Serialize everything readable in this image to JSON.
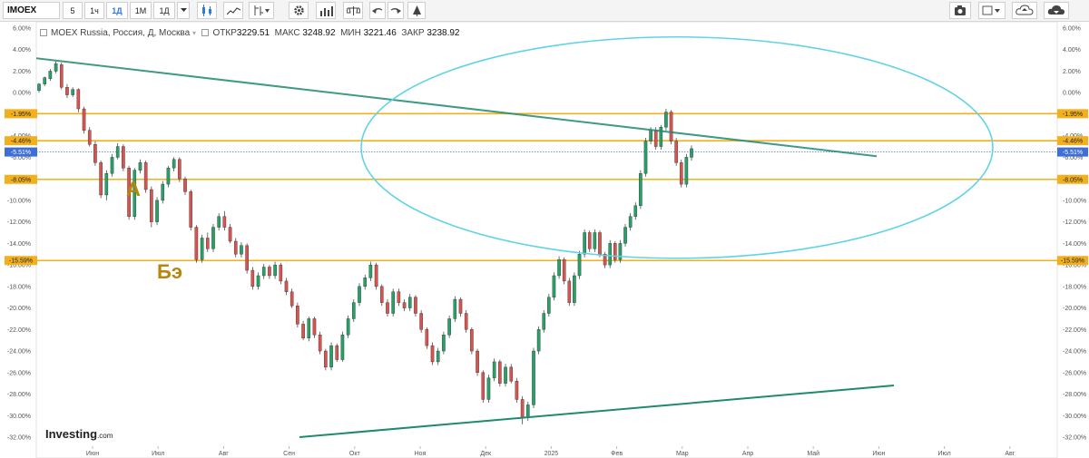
{
  "toolbar": {
    "symbol": "IMOEX",
    "intervals": [
      "5",
      "1ч",
      "1Д",
      "1М",
      "1Д"
    ],
    "active_interval": "1Д",
    "icons": [
      "candles-icon",
      "area-icon",
      "indicators-icon",
      "settings-icon",
      "volume-icon",
      "compare-icon",
      "undo-icon",
      "redo-icon",
      "drawing-icon",
      "camera-icon",
      "color-icon",
      "cloud-upload-icon",
      "cloud-download-icon"
    ]
  },
  "info": {
    "name": "MOEX Russia, Россия, Д, Москва",
    "open_label": "ОТКР",
    "open_value": "3229.51",
    "high_label": "МАКС",
    "high_value": "3248.92",
    "low_label": "МИН",
    "low_value": "3221.46",
    "close_label": "ЗАКР",
    "close_value": "3238.92"
  },
  "brand": "Investing",
  "brand_suffix": ".com",
  "annotations": {
    "a": "А",
    "be": "Бэ"
  },
  "chart_data": {
    "type": "candlestick",
    "y_unit": "%",
    "ylim": [
      -32.0,
      6.0
    ],
    "y_ticks": [
      "6.00%",
      "4.00%",
      "2.00%",
      "0.00%",
      "-2.00%",
      "-4.00%",
      "-6.00%",
      "-8.00%",
      "-10.00%",
      "-12.00%",
      "-14.00%",
      "-16.00%",
      "-18.00%",
      "-20.00%",
      "-22.00%",
      "-24.00%",
      "-26.00%",
      "-28.00%",
      "-30.00%",
      "-32.00%"
    ],
    "x_labels": [
      "Июн",
      "Июл",
      "Авг",
      "Сен",
      "Окт",
      "Ноя",
      "Дек",
      "2025",
      "Фев",
      "Мар",
      "Апр",
      "Май",
      "Июн",
      "Июл",
      "Авг"
    ],
    "price_levels": [
      {
        "value": -1.95,
        "label": "-1.95%",
        "color": "#f2b01e"
      },
      {
        "value": -4.46,
        "label": "-4.46%",
        "color": "#f2b01e"
      },
      {
        "value": -5.51,
        "label": "-5.51%",
        "color": "#3d6fd6"
      },
      {
        "value": -8.05,
        "label": "-8.05%",
        "color": "#f2b01e"
      },
      {
        "value": -15.59,
        "label": "-15.59%",
        "color": "#f2b01e"
      }
    ],
    "colors": {
      "up": "#26a269",
      "down": "#d9534f",
      "trend": "#1e8a6e",
      "ellipse": "#5fd3e8"
    },
    "candles": [
      [
        0.2,
        0.8,
        0.0,
        0.9
      ],
      [
        0.8,
        1.4,
        0.6,
        1.5
      ],
      [
        1.3,
        2.0,
        1.1,
        2.2
      ],
      [
        2.0,
        2.7,
        1.8,
        2.9
      ],
      [
        2.6,
        0.5,
        0.3,
        2.8
      ],
      [
        0.5,
        -0.2,
        -0.5,
        0.8
      ],
      [
        -0.2,
        0.3,
        -0.4,
        0.5
      ],
      [
        0.3,
        -1.5,
        -1.8,
        0.4
      ],
      [
        -1.5,
        -3.5,
        -3.8,
        -1.3
      ],
      [
        -3.5,
        -4.8,
        -5.0,
        -3.2
      ],
      [
        -4.8,
        -6.5,
        -6.8,
        -4.5
      ],
      [
        -6.5,
        -9.5,
        -9.8,
        -6.3
      ],
      [
        -9.5,
        -7.5,
        -10.0,
        -7.2
      ],
      [
        -7.5,
        -6.0,
        -7.8,
        -5.7
      ],
      [
        -6.0,
        -5.0,
        -6.2,
        -4.7
      ],
      [
        -5.0,
        -7.0,
        -7.3,
        -4.8
      ],
      [
        -7.0,
        -11.5,
        -11.8,
        -6.8
      ],
      [
        -11.5,
        -7.2,
        -11.8,
        -7.0
      ],
      [
        -7.2,
        -6.5,
        -7.5,
        -6.2
      ],
      [
        -6.5,
        -9.0,
        -9.3,
        -6.3
      ],
      [
        -9.0,
        -12.0,
        -12.5,
        -8.7
      ],
      [
        -12.0,
        -10.0,
        -12.3,
        -9.7
      ],
      [
        -10.0,
        -8.5,
        -10.3,
        -8.2
      ],
      [
        -8.5,
        -7.0,
        -8.8,
        -6.8
      ],
      [
        -7.0,
        -6.2,
        -7.3,
        -6.0
      ],
      [
        -6.2,
        -8.0,
        -8.3,
        -6.0
      ],
      [
        -8.0,
        -9.2,
        -9.5,
        -7.8
      ],
      [
        -9.2,
        -12.5,
        -12.8,
        -9.0
      ],
      [
        -12.5,
        -15.5,
        -15.8,
        -12.3
      ],
      [
        -15.5,
        -13.5,
        -15.8,
        -13.2
      ],
      [
        -13.5,
        -14.5,
        -14.8,
        -13.0
      ],
      [
        -14.5,
        -12.5,
        -14.8,
        -12.2
      ],
      [
        -12.5,
        -11.5,
        -12.8,
        -11.2
      ],
      [
        -11.5,
        -12.5,
        -12.8,
        -11.0
      ],
      [
        -12.5,
        -13.8,
        -14.0,
        -12.2
      ],
      [
        -13.8,
        -15.0,
        -15.3,
        -13.5
      ],
      [
        -15.0,
        -14.2,
        -15.3,
        -13.9
      ],
      [
        -14.2,
        -16.5,
        -16.8,
        -14.0
      ],
      [
        -16.5,
        -18.0,
        -18.3,
        -16.2
      ],
      [
        -18.0,
        -17.0,
        -18.3,
        -16.7
      ],
      [
        -17.0,
        -16.2,
        -17.3,
        -15.9
      ],
      [
        -16.2,
        -17.0,
        -17.3,
        -16.0
      ],
      [
        -17.0,
        -16.0,
        -17.3,
        -15.7
      ],
      [
        -16.0,
        -17.5,
        -17.8,
        -15.8
      ],
      [
        -17.5,
        -18.5,
        -18.8,
        -17.2
      ],
      [
        -18.5,
        -19.8,
        -20.0,
        -18.2
      ],
      [
        -19.8,
        -21.5,
        -21.8,
        -19.5
      ],
      [
        -21.5,
        -22.8,
        -23.0,
        -21.2
      ],
      [
        -22.8,
        -21.0,
        -23.1,
        -20.8
      ],
      [
        -21.0,
        -22.5,
        -22.8,
        -20.8
      ],
      [
        -22.5,
        -24.0,
        -24.3,
        -22.2
      ],
      [
        -24.0,
        -25.5,
        -25.8,
        -23.8
      ],
      [
        -25.5,
        -23.5,
        -25.8,
        -23.2
      ],
      [
        -23.5,
        -24.8,
        -25.0,
        -23.3
      ],
      [
        -24.8,
        -22.5,
        -25.0,
        -22.2
      ],
      [
        -22.5,
        -21.0,
        -22.8,
        -20.7
      ],
      [
        -21.0,
        -19.5,
        -21.3,
        -19.2
      ],
      [
        -19.5,
        -18.0,
        -19.8,
        -17.7
      ],
      [
        -18.0,
        -17.2,
        -18.3,
        -16.9
      ],
      [
        -17.2,
        -16.0,
        -17.5,
        -15.7
      ],
      [
        -16.0,
        -18.0,
        -18.3,
        -15.8
      ],
      [
        -18.0,
        -19.5,
        -19.8,
        -17.8
      ],
      [
        -19.5,
        -20.5,
        -20.8,
        -19.2
      ],
      [
        -20.5,
        -18.5,
        -20.8,
        -18.2
      ],
      [
        -18.5,
        -19.5,
        -19.8,
        -18.2
      ],
      [
        -19.5,
        -20.0,
        -20.3,
        -19.2
      ],
      [
        -20.0,
        -19.0,
        -20.3,
        -18.7
      ],
      [
        -19.0,
        -20.5,
        -20.8,
        -18.8
      ],
      [
        -20.5,
        -22.0,
        -22.3,
        -20.2
      ],
      [
        -22.0,
        -23.5,
        -23.8,
        -21.8
      ],
      [
        -23.5,
        -25.0,
        -25.3,
        -23.2
      ],
      [
        -25.0,
        -24.0,
        -25.3,
        -23.7
      ],
      [
        -24.0,
        -22.5,
        -24.3,
        -22.2
      ],
      [
        -22.5,
        -21.0,
        -22.8,
        -20.7
      ],
      [
        -21.0,
        -19.2,
        -21.3,
        -18.9
      ],
      [
        -19.2,
        -20.5,
        -20.8,
        -19.0
      ],
      [
        -20.5,
        -22.0,
        -22.3,
        -20.2
      ],
      [
        -22.0,
        -24.0,
        -24.3,
        -21.8
      ],
      [
        -24.0,
        -26.0,
        -26.3,
        -23.8
      ],
      [
        -26.0,
        -28.5,
        -28.8,
        -25.8
      ],
      [
        -28.5,
        -26.5,
        -28.8,
        -26.2
      ],
      [
        -26.5,
        -25.0,
        -26.8,
        -24.7
      ],
      [
        -25.0,
        -27.0,
        -27.3,
        -24.8
      ],
      [
        -27.0,
        -25.5,
        -27.3,
        -25.2
      ],
      [
        -25.5,
        -26.8,
        -27.0,
        -25.2
      ],
      [
        -26.8,
        -28.5,
        -28.8,
        -26.5
      ],
      [
        -28.5,
        -30.2,
        -30.8,
        -28.2
      ],
      [
        -30.2,
        -29.0,
        -30.5,
        -28.7
      ],
      [
        -29.0,
        -24.0,
        -29.3,
        -23.7
      ],
      [
        -24.0,
        -22.0,
        -24.3,
        -21.7
      ],
      [
        -22.0,
        -20.5,
        -22.3,
        -20.2
      ],
      [
        -20.5,
        -19.0,
        -20.8,
        -18.7
      ],
      [
        -19.0,
        -17.0,
        -19.3,
        -16.7
      ],
      [
        -17.0,
        -15.5,
        -17.3,
        -15.2
      ],
      [
        -15.5,
        -17.5,
        -17.8,
        -15.3
      ],
      [
        -17.5,
        -19.5,
        -19.8,
        -17.2
      ],
      [
        -19.5,
        -17.0,
        -19.8,
        -16.7
      ],
      [
        -17.0,
        -15.0,
        -17.3,
        -14.7
      ],
      [
        -15.0,
        -13.0,
        -15.3,
        -12.7
      ],
      [
        -13.0,
        -14.5,
        -14.8,
        -12.8
      ],
      [
        -14.5,
        -13.0,
        -14.8,
        -12.7
      ],
      [
        -13.0,
        -15.0,
        -15.3,
        -12.8
      ],
      [
        -15.0,
        -16.0,
        -16.3,
        -14.8
      ],
      [
        -16.0,
        -14.0,
        -16.3,
        -13.7
      ],
      [
        -14.0,
        -15.5,
        -15.8,
        -13.8
      ],
      [
        -15.5,
        -14.0,
        -15.8,
        -13.7
      ],
      [
        -14.0,
        -12.5,
        -14.3,
        -12.2
      ],
      [
        -12.5,
        -11.5,
        -12.8,
        -11.2
      ],
      [
        -11.5,
        -10.5,
        -11.8,
        -10.2
      ],
      [
        -10.5,
        -7.5,
        -10.8,
        -7.2
      ],
      [
        -7.5,
        -4.5,
        -7.8,
        -4.2
      ],
      [
        -4.5,
        -3.5,
        -4.8,
        -3.2
      ],
      [
        -3.5,
        -5.0,
        -5.3,
        -3.2
      ],
      [
        -5.0,
        -3.2,
        -5.3,
        -3.0
      ],
      [
        -3.2,
        -1.8,
        -3.5,
        -1.5
      ],
      [
        -1.8,
        -4.5,
        -4.8,
        -1.6
      ],
      [
        -4.5,
        -6.5,
        -6.8,
        -4.2
      ],
      [
        -6.5,
        -8.5,
        -8.8,
        -6.2
      ],
      [
        -8.5,
        -6.0,
        -8.8,
        -5.7
      ],
      [
        -6.0,
        -5.2,
        -6.3,
        -4.9
      ]
    ]
  }
}
